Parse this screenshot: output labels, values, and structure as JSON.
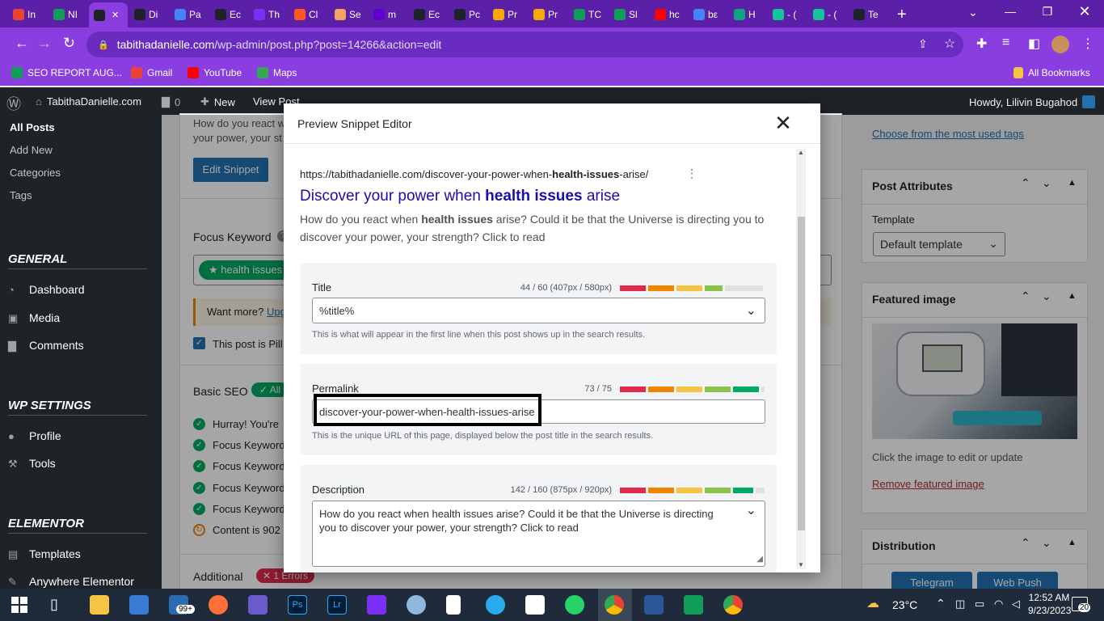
{
  "browser": {
    "tabs": [
      {
        "label": "In",
        "color": "#ea4335"
      },
      {
        "label": "NI",
        "color": "#0f9d58"
      },
      {
        "label": "",
        "color": "#1d2327",
        "active": true
      },
      {
        "label": "Di",
        "color": "#1d2327"
      },
      {
        "label": "Pa",
        "color": "#4285f4"
      },
      {
        "label": "Ec",
        "color": "#1d2327"
      },
      {
        "label": "Th",
        "color": "#7b2ff7"
      },
      {
        "label": "Cl",
        "color": "#ff5722"
      },
      {
        "label": "Se",
        "color": "#f4a460"
      },
      {
        "label": "m",
        "color": "#6001d2"
      },
      {
        "label": "Ec",
        "color": "#1d2327"
      },
      {
        "label": "Pc",
        "color": "#1d2327"
      },
      {
        "label": "Pr",
        "color": "#f6a800"
      },
      {
        "label": "Pr",
        "color": "#f6a800"
      },
      {
        "label": "TC",
        "color": "#0f9d58"
      },
      {
        "label": "Sl",
        "color": "#0f9d58"
      },
      {
        "label": "hc",
        "color": "#ff0000"
      },
      {
        "label": "bε",
        "color": "#4285f4"
      },
      {
        "label": "H",
        "color": "#10a37f"
      },
      {
        "label": "- (",
        "color": "#15c39a"
      },
      {
        "label": "- (",
        "color": "#15c39a"
      },
      {
        "label": "Te",
        "color": "#1d2327"
      }
    ],
    "url_host": "tabithadanielle.com",
    "url_path": "/wp-admin/post.php?post=14266&action=edit",
    "bookmarks": [
      "SEO REPORT AUG...",
      "Gmail",
      "YouTube",
      "Maps"
    ],
    "all_bookmarks": "All Bookmarks"
  },
  "adminbar": {
    "site": "TabithaDanielle.com",
    "comments": "0",
    "new": "New",
    "view_post": "View Post",
    "howdy": "Howdy, Lilivin Bugahod"
  },
  "sidebar": {
    "posts_sub": [
      "All Posts",
      "Add New",
      "Categories",
      "Tags"
    ],
    "general": "GENERAL",
    "general_items": [
      "Dashboard",
      "Media",
      "Comments"
    ],
    "wp_settings": "WP SETTINGS",
    "wp_items": [
      "Profile",
      "Tools"
    ],
    "elementor": "ELEMENTOR",
    "elementor_items": [
      "Templates",
      "Anywhere Elementor"
    ]
  },
  "main": {
    "snippet_text_1": "How do you react w",
    "snippet_text_2": "your power, your st",
    "edit_snippet": "Edit Snippet",
    "focus_keyword_label": "Focus Keyword",
    "focus_keyword_chip": "health issues",
    "want_more": "Want more?",
    "upgrade": "Upg",
    "pillar_label": "This post is Pill",
    "basic_seo": "Basic SEO",
    "basic_badge": "All",
    "checks": [
      "Hurray! You're",
      "Focus Keyword",
      "Focus Keyword",
      "Focus Keyword",
      "Focus Keyword",
      "Content is 902"
    ],
    "additional": "Additional",
    "errors_badge": "1 Errors"
  },
  "right": {
    "most_used_tags": "Choose from the most used tags",
    "post_attributes": "Post Attributes",
    "template_label": "Template",
    "template_value": "Default template",
    "featured_image": "Featured image",
    "click_image": "Click the image to edit or update",
    "remove_image": "Remove featured image",
    "distribution": "Distribution",
    "telegram": "Telegram",
    "web_push": "Web Push"
  },
  "modal": {
    "title": "Preview Snippet Editor",
    "preview_url_prefix": "https://tabithadanielle.com/discover-your-power-when-",
    "preview_url_bold": "health-issues",
    "preview_url_suffix": "-arise/",
    "preview_title_1": "Discover your power when ",
    "preview_title_bold": "health issues",
    "preview_title_2": " arise",
    "preview_desc_1": "How do you react when ",
    "preview_desc_bold": "health issues",
    "preview_desc_2": " arise? Could it be that the Universe is directing you to discover your power, your strength? Click to read",
    "title_label": "Title",
    "title_count": "44 / 60 (407px / 580px)",
    "title_value": "%title%",
    "title_help": "This is what will appear in the first line when this post shows up in the search results.",
    "permalink_label": "Permalink",
    "permalink_count": "73 / 75",
    "permalink_value": "discover-your-power-when-health-issues-arise",
    "permalink_help": "This is the unique URL of this page, displayed below the post title in the search results.",
    "description_label": "Description",
    "description_count": "142 / 160 (875px / 920px)",
    "description_value": "How do you react when health issues arise? Could it be that the Universe is directing you to discover your power, your strength? Click to read"
  },
  "taskbar": {
    "weather": "23°C",
    "time": "12:52 AM",
    "date": "9/23/2023",
    "mail_badge": "99+",
    "notif_badge": "20"
  }
}
